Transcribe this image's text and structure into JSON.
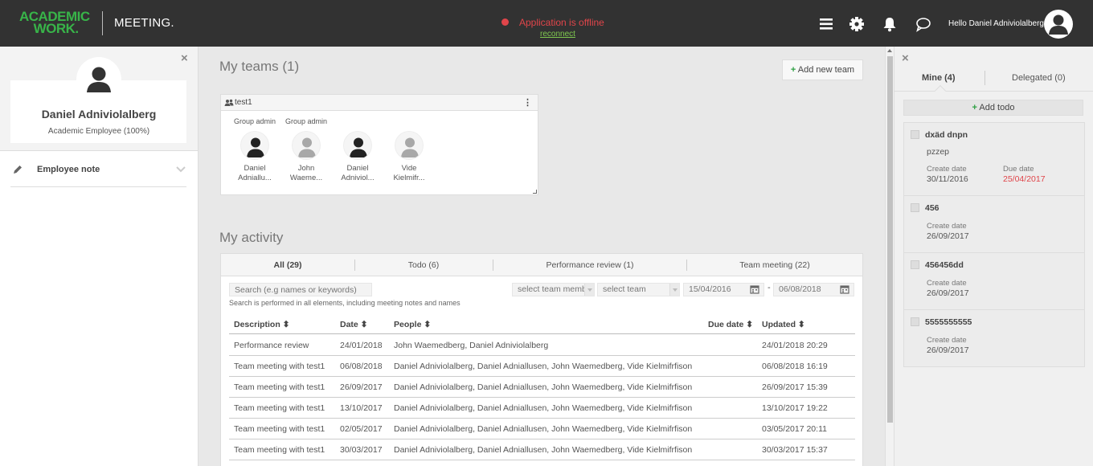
{
  "header": {
    "logo_line1": "ACADEMIC",
    "logo_line2": "WORK.",
    "app_title": "MEETING.",
    "status_text": "Application is offline",
    "reconnect_label": "reconnect",
    "greeting": "Hello Daniel Adniviolalberg!",
    "icons": [
      "menu-icon",
      "gear-icon",
      "bell-icon",
      "chat-icon"
    ],
    "status_color": "#e0454a",
    "brand_color": "#38b449"
  },
  "left_panel": {
    "close_label": "×",
    "name": "Daniel Adniviolalberg",
    "role": "Academic Employee (100%)",
    "note_label": "Employee note"
  },
  "main": {
    "teams_heading": "My teams (1)",
    "add_team_label": "Add new team",
    "team": {
      "name": "test1",
      "menu": "⋮",
      "members": [
        {
          "role": "Group admin",
          "name_line1": "Daniel",
          "name_line2": "Adniallu...",
          "has_photo": true
        },
        {
          "role": "Group admin",
          "name_line1": "John",
          "name_line2": "Waeme...",
          "has_photo": false
        },
        {
          "role": "",
          "name_line1": "Daniel",
          "name_line2": "Adniviol...",
          "has_photo": true
        },
        {
          "role": "",
          "name_line1": "Vide",
          "name_line2": "Kielmifr...",
          "has_photo": false
        }
      ]
    },
    "activity_heading": "My activity",
    "tabs": [
      "All (29)",
      "Todo (6)",
      "Performance review (1)",
      "Team meeting (22)"
    ],
    "active_tab": 0,
    "filters": {
      "search_placeholder": "Search (e.g names or keywords)",
      "team_member": "select team memb",
      "team": "select team",
      "date_from": "15/04/2016",
      "date_sep": "-",
      "date_to": "06/08/2018",
      "hint": "Search is performed in all elements, including meeting notes and names"
    },
    "columns": {
      "description": "Description ⬍",
      "date": "Date ⬍",
      "people": "People ⬍",
      "due_date": "Due date ⬍",
      "updated": "Updated ⬍"
    },
    "rows": [
      {
        "description": "Performance review",
        "date": "24/01/2018",
        "people": "John Waemedberg, Daniel Adniviolalberg",
        "due": "",
        "updated": "24/01/2018 20:29"
      },
      {
        "description": "Team meeting with test1",
        "date": "06/08/2018",
        "people": "Daniel Adniviolalberg, Daniel Adniallusen, John Waemedberg, Vide Kielmifrfison",
        "due": "",
        "updated": "06/08/2018 16:19"
      },
      {
        "description": "Team meeting with test1",
        "date": "26/09/2017",
        "people": "Daniel Adniviolalberg, Daniel Adniallusen, John Waemedberg, Vide Kielmifrfison",
        "due": "",
        "updated": "26/09/2017 15:39"
      },
      {
        "description": "Team meeting with test1",
        "date": "13/10/2017",
        "people": "Daniel Adniviolalberg, Daniel Adniallusen, John Waemedberg, Vide Kielmifrfison",
        "due": "",
        "updated": "13/10/2017 19:22"
      },
      {
        "description": "Team meeting with test1",
        "date": "02/05/2017",
        "people": "Daniel Adniviolalberg, Daniel Adniallusen, John Waemedberg, Vide Kielmifrfison",
        "due": "",
        "updated": "03/05/2017 20:11"
      },
      {
        "description": "Team meeting with test1",
        "date": "30/03/2017",
        "people": "Daniel Adniviolalberg, Daniel Adniallusen, John Waemedberg, Vide Kielmifrfison",
        "due": "",
        "updated": "30/03/2017 15:37"
      }
    ]
  },
  "right_panel": {
    "close_label": "×",
    "tab_mine": "Mine (4)",
    "tab_delegated": "Delegated (0)",
    "add_todo_label": "Add todo",
    "create_label": "Create date",
    "due_label": "Due date",
    "todos": [
      {
        "title": "dxäd dnpn",
        "desc": "pzzep",
        "create": "30/11/2016",
        "due": "25/04/2017"
      },
      {
        "title": "456",
        "desc": "",
        "create": "26/09/2017",
        "due": ""
      },
      {
        "title": "456456dd",
        "desc": "",
        "create": "26/09/2017",
        "due": ""
      },
      {
        "title": "5555555555",
        "desc": "",
        "create": "26/09/2017",
        "due": ""
      }
    ]
  }
}
